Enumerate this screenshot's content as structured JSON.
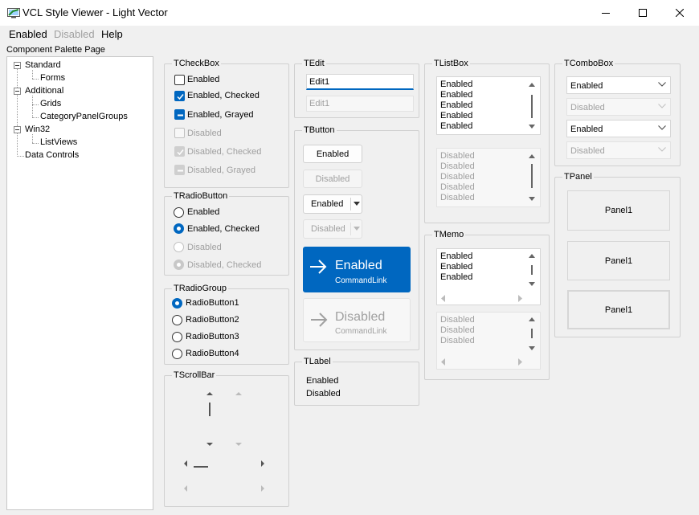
{
  "window": {
    "title": "VCL Style Viewer - Light Vector"
  },
  "menu": {
    "enabled": "Enabled",
    "disabled": "Disabled",
    "help": "Help"
  },
  "palette": {
    "label": "Component Palette Page",
    "tree": {
      "standard": "Standard",
      "forms": "Forms",
      "additional": "Additional",
      "grids": "Grids",
      "category_panel_groups": "CategoryPanelGroups",
      "win32": "Win32",
      "list_views": "ListViews",
      "data_controls": "Data Controls"
    }
  },
  "checkbox": {
    "caption": "TCheckBox",
    "items": [
      "Enabled",
      "Enabled, Checked",
      "Enabled, Grayed",
      "Disabled",
      "Disabled, Checked",
      "Disabled, Grayed"
    ]
  },
  "radiobutton": {
    "caption": "TRadioButton",
    "items": [
      "Enabled",
      "Enabled, Checked",
      "Disabled",
      "Disabled, Checked"
    ]
  },
  "radiogroup": {
    "caption": "TRadioGroup",
    "items": [
      "RadioButton1",
      "RadioButton2",
      "RadioButton3",
      "RadioButton4"
    ]
  },
  "scrollbar": {
    "caption": "TScrollBar"
  },
  "edit": {
    "caption": "TEdit",
    "enabled_value": "Edit1",
    "disabled_value": "Edit1"
  },
  "button": {
    "caption": "TButton",
    "enabled": "Enabled",
    "disabled": "Disabled",
    "split_enabled": "Enabled",
    "split_disabled": "Disabled",
    "cmd_enabled_title": "Enabled",
    "cmd_enabled_sub": "CommandLink",
    "cmd_disabled_title": "Disabled",
    "cmd_disabled_sub": "CommandLink"
  },
  "label": {
    "caption": "TLabel",
    "enabled": "Enabled",
    "disabled": "Disabled"
  },
  "listbox": {
    "caption": "TListBox",
    "enabled_items": [
      "Enabled",
      "Enabled",
      "Enabled",
      "Enabled",
      "Enabled"
    ],
    "disabled_items": [
      "Disabled",
      "Disabled",
      "Disabled",
      "Disabled",
      "Disabled"
    ]
  },
  "memo": {
    "caption": "TMemo",
    "enabled_lines": [
      "Enabled",
      "Enabled",
      "Enabled"
    ],
    "disabled_lines": [
      "Disabled",
      "Disabled",
      "Disabled"
    ]
  },
  "combobox": {
    "caption": "TComboBox",
    "values": [
      "Enabled",
      "Disabled",
      "Enabled",
      "Disabled"
    ]
  },
  "panel": {
    "caption": "TPanel",
    "items": [
      "Panel1",
      "Panel1",
      "Panel1"
    ]
  },
  "colors": {
    "accent": "#0067c0",
    "disabled_text": "#a0a0a0",
    "background": "#f0f0f0"
  }
}
